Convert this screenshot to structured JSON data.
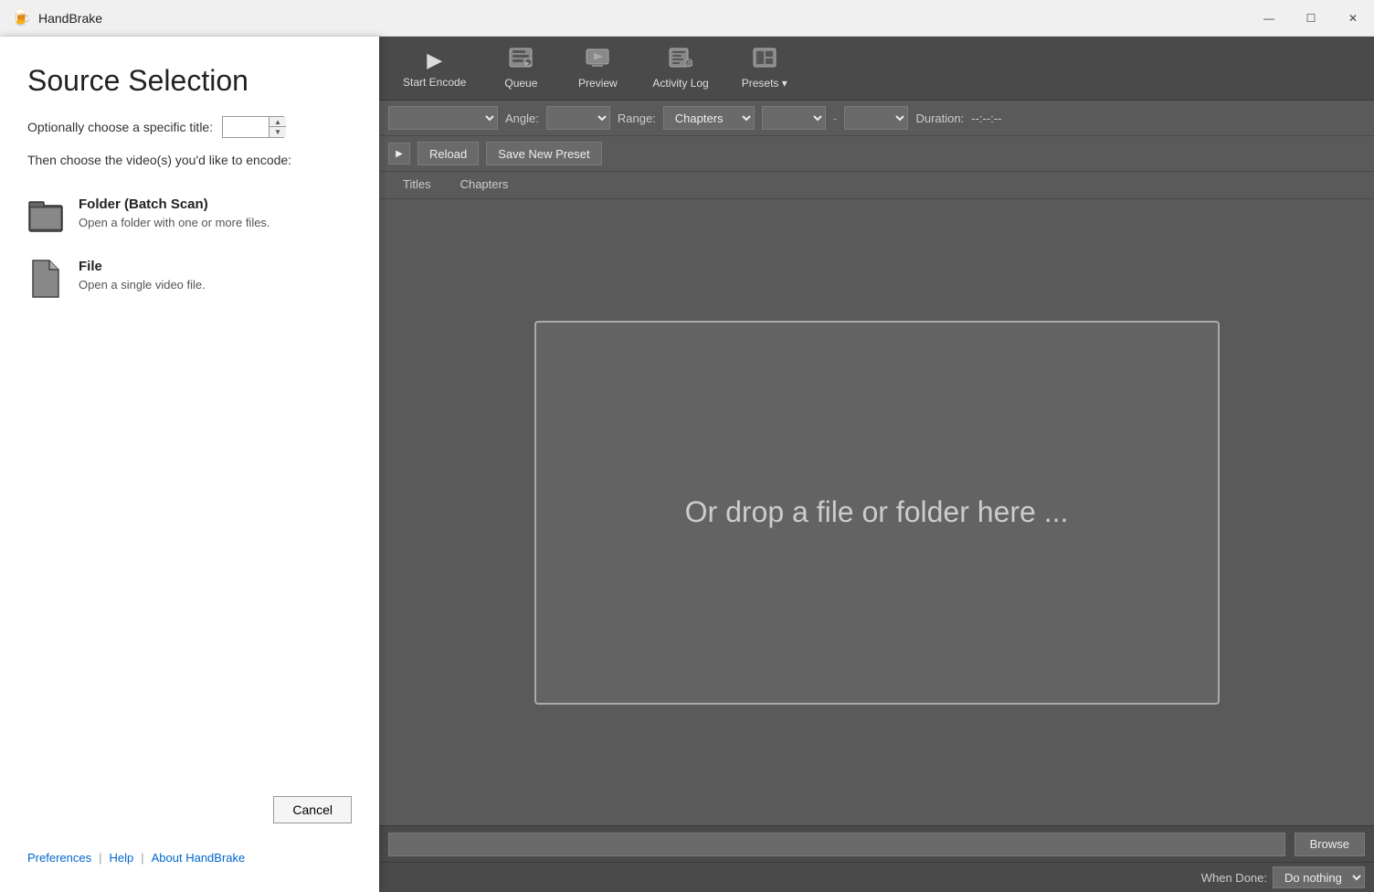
{
  "titlebar": {
    "app_name": "HandBrake",
    "app_icon": "🍺",
    "minimize_icon": "—",
    "maximize_icon": "☐",
    "close_icon": "✕"
  },
  "source_panel": {
    "title": "Source Selection",
    "title_label": "Optionally choose a specific title:",
    "choose_label": "Then choose the video(s) you'd like to encode:",
    "folder_option": {
      "title": "Folder (Batch Scan)",
      "description": "Open a folder with one or more files."
    },
    "file_option": {
      "title": "File",
      "description": "Open a single video file."
    },
    "cancel_label": "Cancel",
    "preferences_link": "Preferences",
    "help_link": "Help",
    "about_link": "About HandBrake"
  },
  "toolbar": {
    "start_encode_label": "Start Encode",
    "queue_label": "Queue",
    "preview_label": "Preview",
    "activity_log_label": "Activity Log",
    "presets_label": "Presets"
  },
  "controls": {
    "angle_label": "Angle:",
    "range_label": "Range:",
    "chapters_label": "Chapters",
    "duration_label": "Duration:",
    "duration_value": "--:--:--"
  },
  "presets_bar": {
    "reload_label": "Reload",
    "save_preset_label": "Save New Preset"
  },
  "tabs": [
    {
      "label": "Titles",
      "active": false
    },
    {
      "label": "Chapters",
      "active": false
    }
  ],
  "drop_zone": {
    "text": "Or drop a file or folder here ..."
  },
  "bottom": {
    "browse_label": "Browse",
    "when_done_label": "When Done:",
    "when_done_value": "Do nothing"
  }
}
